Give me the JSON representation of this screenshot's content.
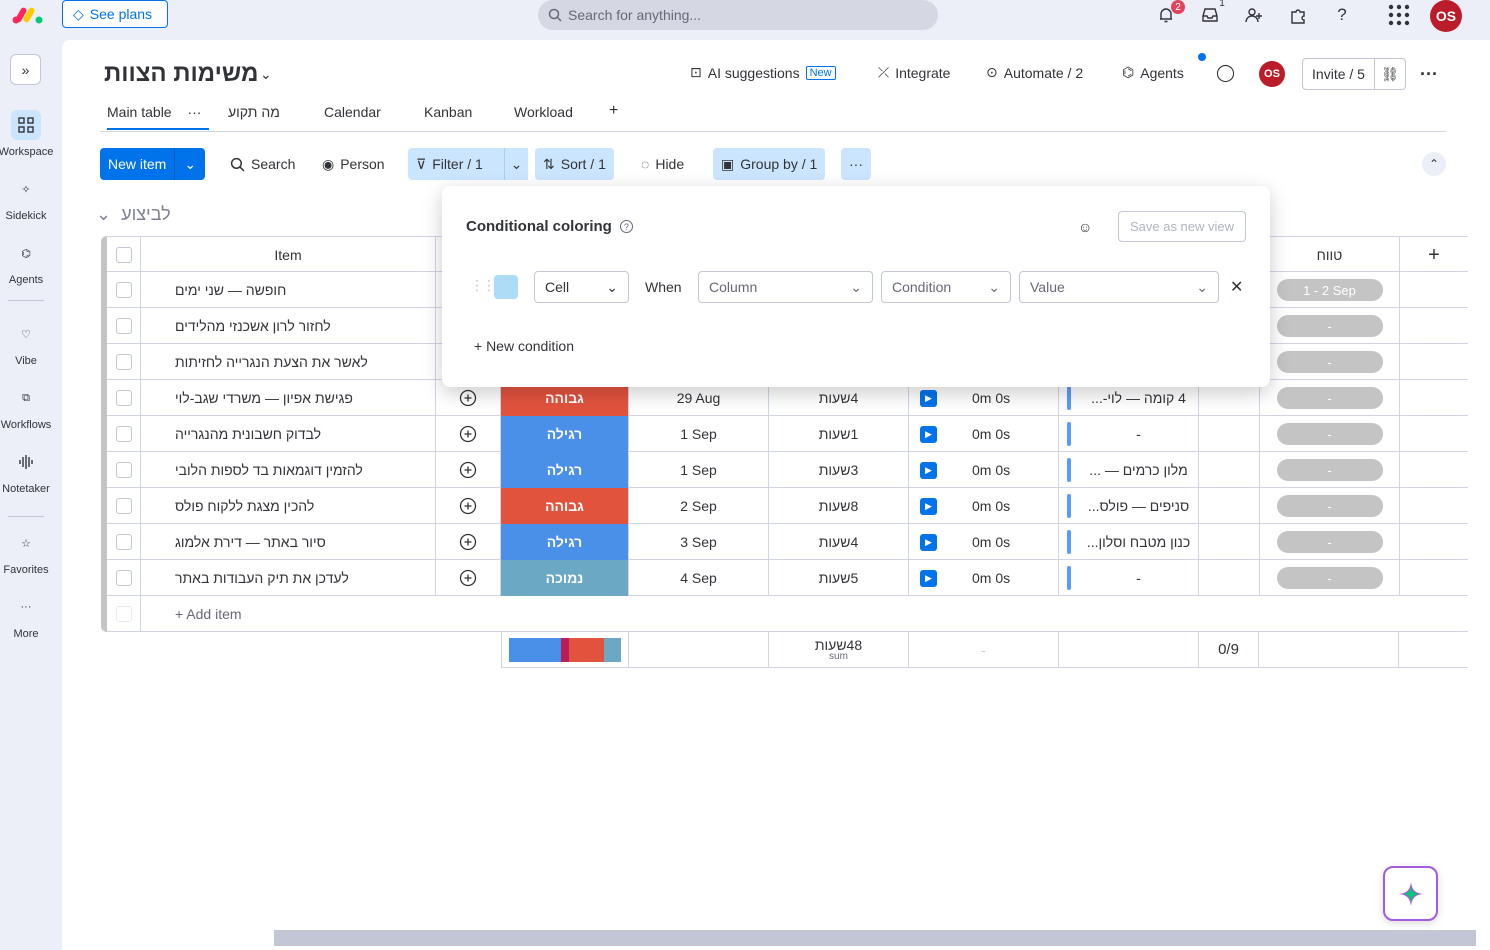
{
  "top": {
    "see_plans": "See plans",
    "search_placeholder": "Search for anything...",
    "notifications_badge": "2",
    "inbox_badge": "1",
    "avatar_initials": "OS"
  },
  "sidebar": {
    "items": [
      {
        "label": "Workspace",
        "icon": "grid-icon"
      },
      {
        "label": "Sidekick",
        "icon": "sparkle-icon"
      },
      {
        "label": "Agents",
        "icon": "agents-icon"
      },
      {
        "label": "Vibe",
        "icon": "heart-icon"
      },
      {
        "label": "Workflows",
        "icon": "workflows-icon"
      },
      {
        "label": "Notetaker",
        "icon": "waveform-icon"
      },
      {
        "label": "Favorites",
        "icon": "star-icon"
      },
      {
        "label": "More",
        "icon": "more-icon"
      }
    ]
  },
  "board": {
    "title": "משימות הצוות",
    "ai_suggestions": "AI suggestions",
    "new_tag": "New",
    "integrate": "Integrate",
    "automate": "Automate / 2",
    "agents": "Agents",
    "invite": "Invite / 5",
    "avatar_initials": "OS"
  },
  "tabs": [
    "Main table",
    "מה תקוע",
    "Calendar",
    "Kanban",
    "Workload",
    "+"
  ],
  "toolbar": {
    "new_item": "New item",
    "search": "Search",
    "person": "Person",
    "filter": "Filter / 1",
    "sort": "Sort / 1",
    "hide": "Hide",
    "group_by": "Group by / 1"
  },
  "group": {
    "title": "לביצוע",
    "color": "#c4c4c4"
  },
  "table": {
    "item_header": "Item",
    "last_header": "טווח",
    "add_item": "+ Add item",
    "rows": [
      {
        "item": "חופשה — שני ימים",
        "priority": "",
        "date": "",
        "hours": "",
        "time": "",
        "link": "",
        "timeline": "1 - 2 Sep"
      },
      {
        "item": "לחזור לרון אשכנזי מהלידים",
        "priority": "",
        "date": "",
        "hours": "",
        "time": "",
        "link": "",
        "timeline": "-"
      },
      {
        "item": "לאשר את הצעת הנגרייה לחזיתות",
        "priority": "",
        "date": "",
        "hours": "",
        "time": "",
        "link": "",
        "timeline": "-"
      },
      {
        "item": "פגישת אפיון — משרדי שגב-לוי",
        "priority": "גבוהה",
        "priority_color": "#e2533e",
        "date": "29 Aug",
        "hours": "4שעות",
        "time": "0m 0s",
        "link": "4 קומה — לוי-...",
        "timeline": "-"
      },
      {
        "item": "לבדוק חשבונית מהנגרייה",
        "priority": "רגילה",
        "priority_color": "#4a90e8",
        "date": "1 Sep",
        "hours": "1שעות",
        "time": "0m 0s",
        "link": "-",
        "timeline": "-"
      },
      {
        "item": "להזמין דוגמאות בד לספות הלובי",
        "priority": "רגילה",
        "priority_color": "#4a90e8",
        "date": "1 Sep",
        "hours": "3שעות",
        "time": "0m 0s",
        "link": "מלון כרמים — ...",
        "timeline": "-"
      },
      {
        "item": "להכין מצגת ללקוח פולס",
        "priority": "גבוהה",
        "priority_color": "#e2533e",
        "date": "2 Sep",
        "hours": "8שעות",
        "time": "0m 0s",
        "link": "סניפים — פולס...",
        "timeline": "-"
      },
      {
        "item": "סיור באתר — דירת אלמוג",
        "priority": "רגילה",
        "priority_color": "#4a90e8",
        "date": "3 Sep",
        "hours": "4שעות",
        "time": "0m 0s",
        "link": "כנון מטבח וסלון...",
        "timeline": "-"
      },
      {
        "item": "לעדכן את תיק העבודות באתר",
        "priority": "נמוכה",
        "priority_color": "#6aa8c4",
        "date": "4 Sep",
        "hours": "5שעות",
        "time": "0m 0s",
        "link": "-",
        "timeline": "-"
      }
    ]
  },
  "summary": {
    "hours_total": "48שעות",
    "hours_sub": "sum",
    "time": "-",
    "count": "0/9"
  },
  "popup": {
    "title": "Conditional coloring",
    "save_view": "Save as new view",
    "cell": "Cell",
    "when": "When",
    "column": "Column",
    "condition": "Condition",
    "value": "Value",
    "new_condition": "+ New condition",
    "swatch_color": "#aedcf7"
  }
}
